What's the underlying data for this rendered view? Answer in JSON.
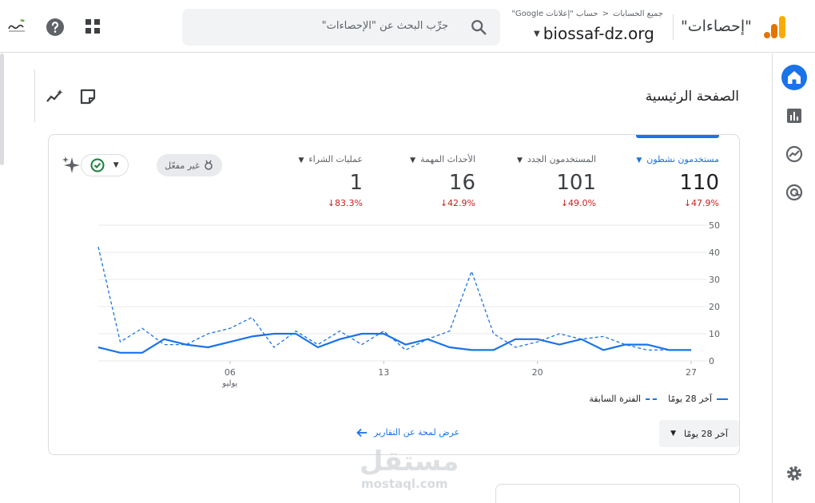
{
  "header": {
    "property_title": "\"إحصاءات\"",
    "breadcrumb": {
      "all_accounts": "جميع الحسابات",
      "sep": "<",
      "account": "حساب \"إعلانات Google\""
    },
    "property_name": "biossaf-dz.org",
    "search": {
      "placeholder": "جرِّب البحث عن \"الإحصاءات\""
    }
  },
  "page": {
    "title": "الصفحة الرئيسية"
  },
  "metrics": [
    {
      "label": "مستخدمون نشطون",
      "value": "110",
      "change": "47.9%",
      "active": true
    },
    {
      "label": "المستخدمون الجدد",
      "value": "101",
      "change": "49.0%",
      "active": false
    },
    {
      "label": "الأحداث المهمة",
      "value": "16",
      "change": "42.9%",
      "active": false
    },
    {
      "label": "عمليات الشراء",
      "value": "1",
      "change": "83.3%",
      "active": false
    }
  ],
  "status_chip": "غير مفعّل",
  "legend": {
    "current": "آخر 28 يومًا",
    "previous": "الفترة السابقة"
  },
  "date_range": {
    "label": "آخر 28 يومًا"
  },
  "reports_link": "عرض لمحة عن التقارير",
  "watermark": {
    "ar": "مستقل",
    "en": "mostaql.com"
  },
  "colors": {
    "accent": "#1a73e8",
    "negative": "#c5221f"
  },
  "chart_data": {
    "type": "line",
    "x": [
      1,
      2,
      3,
      4,
      5,
      6,
      7,
      8,
      9,
      10,
      11,
      12,
      13,
      14,
      15,
      16,
      17,
      18,
      19,
      20,
      21,
      22,
      23,
      24,
      25,
      26,
      27,
      28
    ],
    "x_tick_labels": [
      {
        "x": 7,
        "label": "06",
        "sub": "يوليو"
      },
      {
        "x": 14,
        "label": "13"
      },
      {
        "x": 21,
        "label": "20"
      },
      {
        "x": 28,
        "label": "27"
      }
    ],
    "ylim": [
      0,
      50
    ],
    "y_ticks": [
      0,
      10,
      20,
      30,
      40,
      50
    ],
    "y_axis_side": "right",
    "grid": true,
    "legend_position": "bottom-right",
    "series": [
      {
        "name": "آخر 28 يومًا",
        "style": "solid",
        "values": [
          5,
          3,
          3,
          8,
          6,
          5,
          7,
          9,
          10,
          10,
          5,
          8,
          10,
          10,
          6,
          8,
          5,
          4,
          4,
          8,
          8,
          6,
          8,
          4,
          6,
          6,
          4,
          4
        ]
      },
      {
        "name": "الفترة السابقة",
        "style": "dashed",
        "values": [
          42,
          7,
          12,
          6,
          6,
          10,
          12,
          16,
          5,
          11,
          6,
          11,
          6,
          11,
          4,
          8,
          11,
          33,
          10,
          5,
          7,
          10,
          8,
          9,
          6,
          4,
          4,
          4
        ]
      }
    ]
  }
}
